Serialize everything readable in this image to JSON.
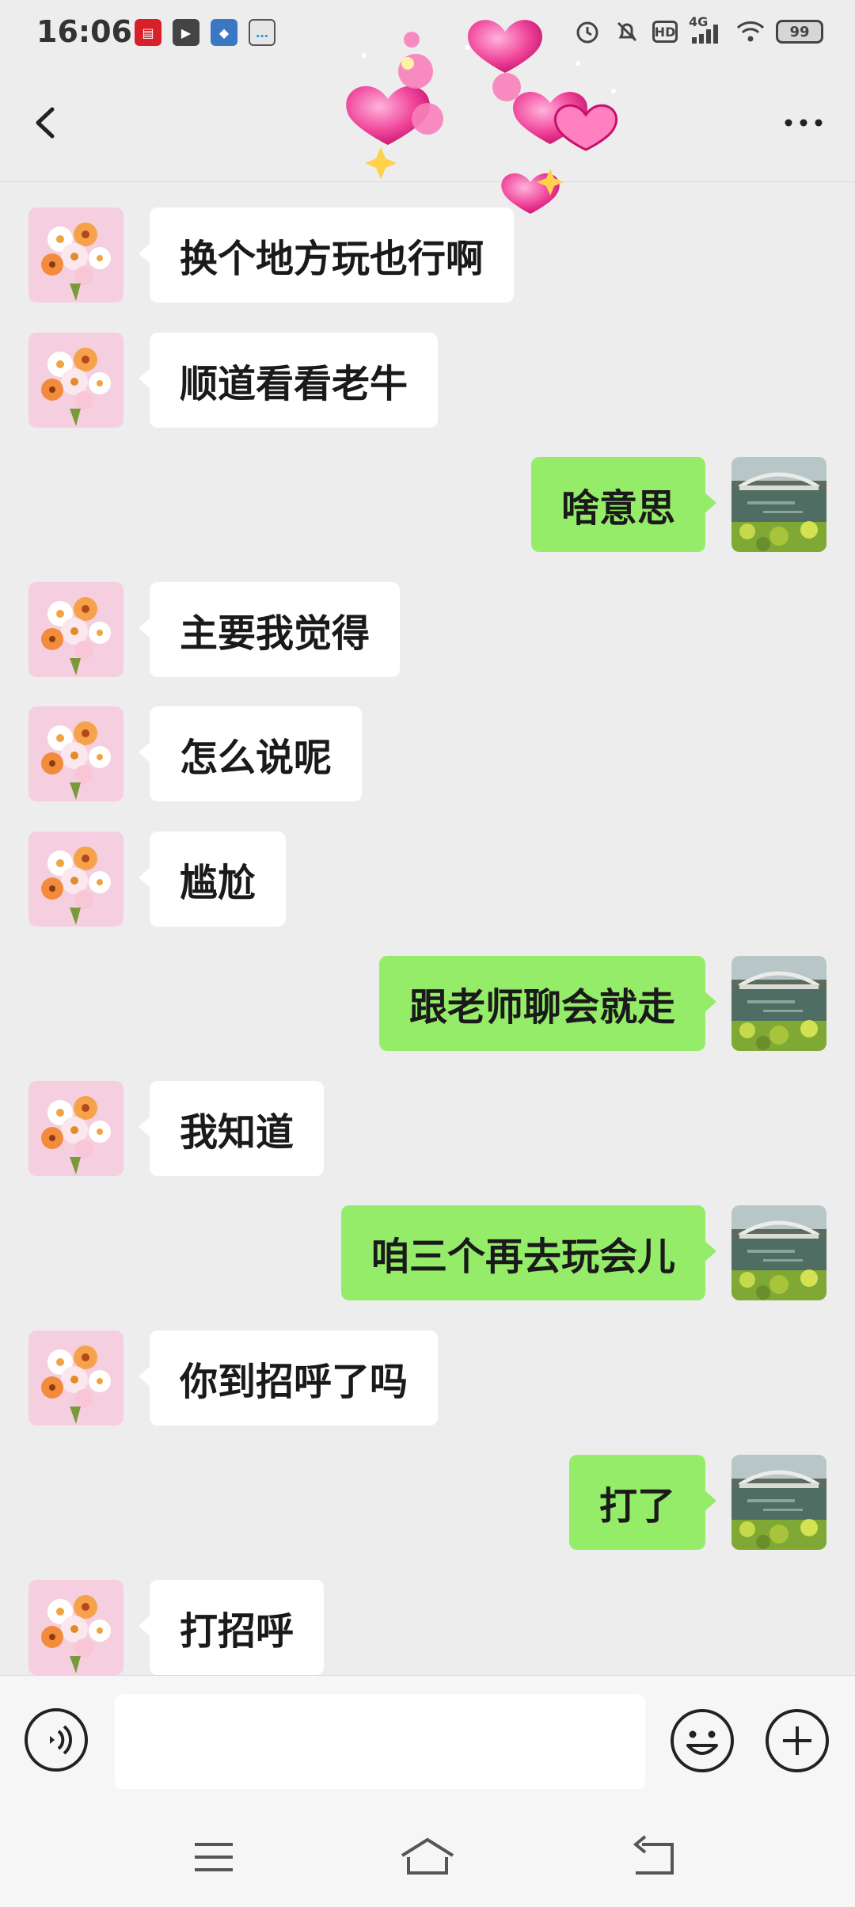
{
  "status_bar": {
    "time": "16:06",
    "network": "4G",
    "hd": "HD",
    "battery": "99",
    "notification_icons": [
      "news-app-icon",
      "video-play-icon",
      "game-app-icon",
      "chat-app-icon"
    ],
    "system_icons": [
      "alarm-icon",
      "mute-bell-icon",
      "hd-icon",
      "signal-icon",
      "wifi-icon",
      "battery-icon"
    ]
  },
  "header": {
    "title": "",
    "back_icon": "back-chevron-icon",
    "more_icon": "more-dots-icon"
  },
  "colors": {
    "background": "#ededed",
    "incoming_bubble": "#ffffff",
    "outgoing_bubble": "#95ec69",
    "heart": "#f0449a"
  },
  "messages": [
    {
      "side": "left",
      "text": "换个地方玩也行啊"
    },
    {
      "side": "left",
      "text": "顺道看看老牛"
    },
    {
      "side": "right",
      "text": "啥意思"
    },
    {
      "side": "left",
      "text": "主要我觉得"
    },
    {
      "side": "left",
      "text": "怎么说呢"
    },
    {
      "side": "left",
      "text": "尴尬"
    },
    {
      "side": "right",
      "text": "跟老师聊会就走"
    },
    {
      "side": "left",
      "text": "我知道"
    },
    {
      "side": "right",
      "text": "咱三个再去玩会儿"
    },
    {
      "side": "left",
      "text": "你到招呼了吗"
    },
    {
      "side": "right",
      "text": "打了"
    },
    {
      "side": "left",
      "text": "打招呼"
    }
  ],
  "input_bar": {
    "text_value": "",
    "voice_icon": "voice-icon",
    "emoji_icon": "emoji-icon",
    "plus_icon": "plus-icon"
  },
  "system_nav": {
    "buttons": [
      "menu-icon",
      "home-icon",
      "back-icon"
    ]
  }
}
